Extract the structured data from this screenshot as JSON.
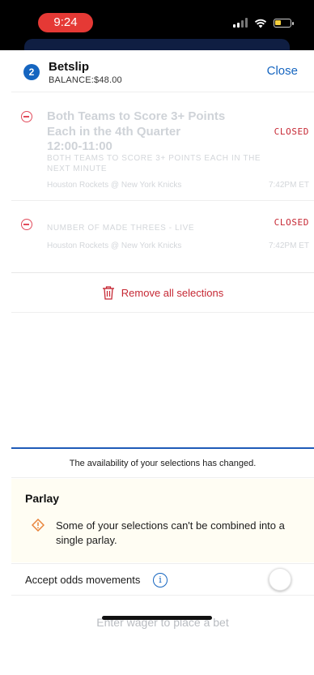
{
  "status_bar": {
    "time": "9:24",
    "icons": [
      "signal-icon",
      "wifi-icon",
      "battery-icon"
    ],
    "time_pill_color": "#e53935"
  },
  "header": {
    "badge_count": "2",
    "title": "Betslip",
    "balance": "BALANCE:$48.00",
    "close_label": "Close"
  },
  "selections": [
    {
      "title": "Both Teams to Score 3+ Points Each in the 4th Quarter",
      "time_range": "12:00-11:00",
      "market": "BOTH TEAMS TO SCORE 3+ POINTS EACH IN THE NEXT MINUTE",
      "teams": "Houston Rockets @ New York Knicks",
      "game_time": "7:42PM ET",
      "status": "CLOSED"
    },
    {
      "title": "",
      "market": "NUMBER OF MADE THREES - LIVE",
      "teams": "Houston Rockets @ New York Knicks",
      "game_time": "7:42PM ET",
      "status": "CLOSED"
    }
  ],
  "remove_all_label": "Remove all selections",
  "availability_notice": "The availability of your selections has changed.",
  "parlay": {
    "title": "Parlay",
    "message": "Some of your selections can't be combined into a single parlay."
  },
  "odds": {
    "label": "Accept odds movements",
    "toggle_on": false
  },
  "wager_placeholder": "Enter wager to place a bet",
  "colors": {
    "accent_blue": "#1565c0",
    "closed_red": "#c62834",
    "warning_orange": "#e8833a"
  }
}
